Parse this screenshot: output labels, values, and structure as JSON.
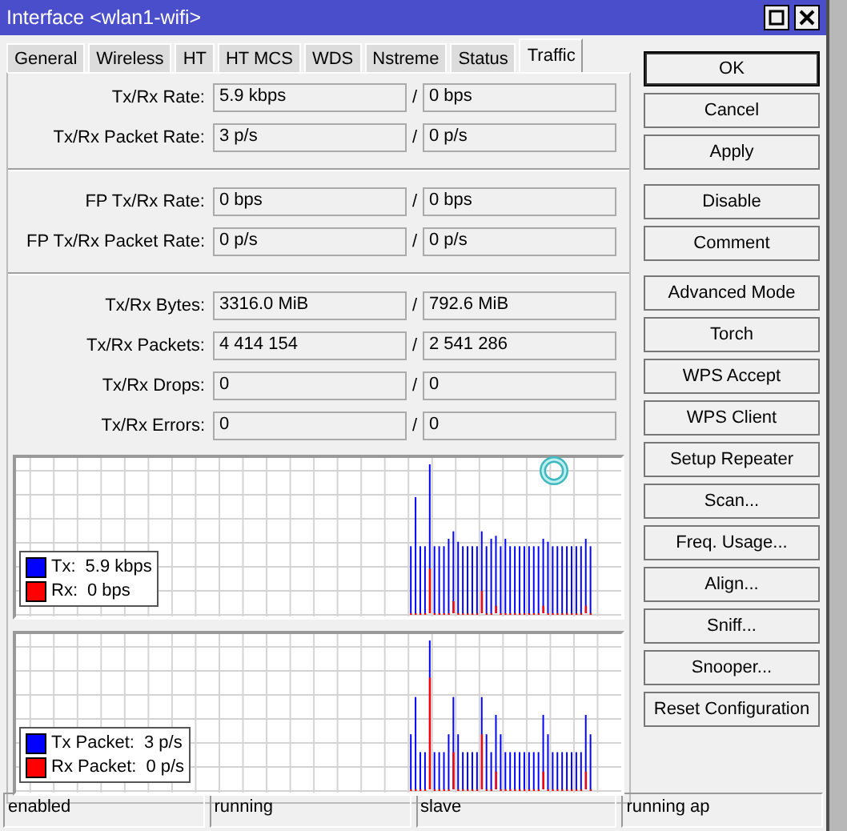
{
  "window": {
    "title": "Interface <wlan1-wifi>"
  },
  "title_buttons": [
    {
      "kind": "maximize"
    },
    {
      "kind": "close"
    }
  ],
  "tabs": [
    {
      "label": "General",
      "selected": false
    },
    {
      "label": "Wireless",
      "selected": false
    },
    {
      "label": "HT",
      "selected": false
    },
    {
      "label": "HT MCS",
      "selected": false
    },
    {
      "label": "WDS",
      "selected": false
    },
    {
      "label": "Nstreme",
      "selected": false
    },
    {
      "label": "Status",
      "selected": false
    },
    {
      "label": "Traffic",
      "selected": true
    }
  ],
  "field_groups": [
    [
      {
        "label": "Tx/Rx Rate:",
        "tx": "5.9 kbps",
        "rx": "0 bps"
      },
      {
        "label": "Tx/Rx Packet Rate:",
        "tx": "3 p/s",
        "rx": "0 p/s"
      }
    ],
    [
      {
        "label": "FP Tx/Rx Rate:",
        "tx": "0 bps",
        "rx": "0 bps"
      },
      {
        "label": "FP Tx/Rx Packet Rate:",
        "tx": "0 p/s",
        "rx": "0 p/s"
      }
    ],
    [
      {
        "label": "Tx/Rx Bytes:",
        "tx": "3316.0 MiB",
        "rx": "792.6 MiB"
      },
      {
        "label": "Tx/Rx Packets:",
        "tx": "4 414 154",
        "rx": "2 541 286"
      },
      {
        "label": "Tx/Rx Drops:",
        "tx": "0",
        "rx": "0"
      },
      {
        "label": "Tx/Rx Errors:",
        "tx": "0",
        "rx": "0"
      }
    ]
  ],
  "separator": "/",
  "graphs": [
    {
      "legend": [
        {
          "label": "Tx:",
          "value": "5.9 kbps",
          "color": "#0000ff"
        },
        {
          "label": "Rx:",
          "value": "0 bps",
          "color": "#ff0000"
        }
      ],
      "loading": true
    },
    {
      "legend": [
        {
          "label": "Tx Packet:",
          "value": "3 p/s",
          "color": "#0000ff"
        },
        {
          "label": "Rx Packet:",
          "value": "0 p/s",
          "color": "#ff0000"
        }
      ],
      "loading": false
    }
  ],
  "button_groups": [
    [
      {
        "label": "OK",
        "default": true
      },
      {
        "label": "Cancel",
        "default": false
      },
      {
        "label": "Apply",
        "default": false
      }
    ],
    [
      {
        "label": "Disable",
        "default": false
      },
      {
        "label": "Comment",
        "default": false
      }
    ],
    [
      {
        "label": "Advanced Mode",
        "default": false
      },
      {
        "label": "Torch",
        "default": false
      },
      {
        "label": "WPS Accept",
        "default": false
      },
      {
        "label": "WPS Client",
        "default": false
      },
      {
        "label": "Setup Repeater",
        "default": false
      },
      {
        "label": "Scan...",
        "default": false
      },
      {
        "label": "Freq. Usage...",
        "default": false
      },
      {
        "label": "Align...",
        "default": false
      },
      {
        "label": "Sniff...",
        "default": false
      },
      {
        "label": "Snooper...",
        "default": false
      },
      {
        "label": "Reset Configuration",
        "default": false
      }
    ]
  ],
  "status_bar": [
    "enabled",
    "running",
    "slave",
    "running ap"
  ]
}
